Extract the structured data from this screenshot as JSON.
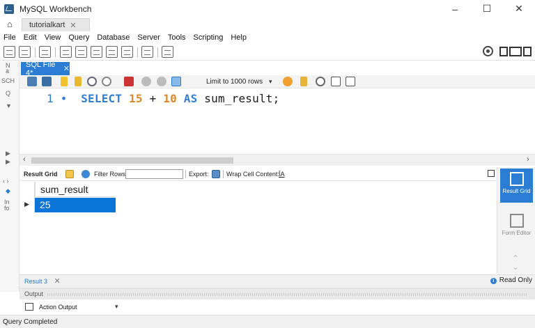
{
  "window": {
    "title": "MySQL Workbench",
    "minimize": "–",
    "maximize": "☐",
    "close": "✕"
  },
  "tabs": {
    "home_glyph": "⌂",
    "connection_tab": "tutorialkart",
    "close": "✕"
  },
  "menu": [
    "File",
    "Edit",
    "View",
    "Query",
    "Database",
    "Server",
    "Tools",
    "Scripting",
    "Help"
  ],
  "sidebar": {
    "labels": [
      "N",
      "a",
      "SCH",
      "Q",
      "▼"
    ]
  },
  "editor": {
    "tab_label": "SQL File 4*",
    "tab_close": "✕",
    "limit_label": "Limit to 1000 rows",
    "limit_caret": "▾",
    "line_number": "1",
    "line_dot": "•",
    "sql": {
      "kw_select": "SELECT",
      "num1": "15",
      "plus": "+",
      "num2": "10",
      "kw_as": "AS",
      "rest": "sum_result;"
    },
    "scroll_left": "‹",
    "scroll_right": "›"
  },
  "result_toolbar": {
    "result_grid": "Result Grid",
    "filter_rows": "Filter Rows:",
    "filter_value": "",
    "export": "Export:",
    "wrap": "Wrap Cell Content:",
    "wrap_glyph": "ĪA"
  },
  "grid": {
    "column": "sum_result",
    "row_marker": "▶",
    "value": "25"
  },
  "right_panel": {
    "result_grid": "Result Grid",
    "form_editor": "Form Editor"
  },
  "bottom": {
    "result_tab": "Result 3",
    "result_close": "✕",
    "read_only": "Read Only",
    "info": "i",
    "output_label": "Output",
    "action_output": "Action Output",
    "action_caret": "▾",
    "nav_lr": "‹ ›",
    "nav_down": "◆"
  },
  "status": {
    "text": "Query Completed"
  },
  "colors": {
    "accent": "#2b7cd3",
    "selection": "#0a74d9",
    "keyword": "#2d7fd5",
    "number": "#e0892a"
  }
}
